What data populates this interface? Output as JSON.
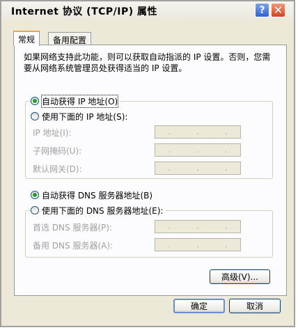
{
  "window": {
    "title": "Internet 协议 (TCP/IP) 属性",
    "help_glyph": "?",
    "close_glyph": "✕"
  },
  "tabs": [
    {
      "label": "常规"
    },
    {
      "label": "备用配置"
    }
  ],
  "description": "如果网络支持此功能，则可以获取自动指派的 IP 设置。否则，您需要从网络系统管理员处获得适当的 IP 设置。",
  "ip_group": {
    "auto_label": "自动获得 IP 地址(O)",
    "manual_label": "使用下面的 IP 地址(S):",
    "fields": [
      {
        "label": "IP 地址(I):"
      },
      {
        "label": "子网掩码(U):"
      },
      {
        "label": "默认网关(D):"
      }
    ]
  },
  "dns_group": {
    "auto_label": "自动获得 DNS 服务器地址(B)",
    "manual_label": "使用下面的 DNS 服务器地址(E):",
    "fields": [
      {
        "label": "首选 DNS 服务器(P):"
      },
      {
        "label": "备用 DNS 服务器(A):"
      }
    ]
  },
  "ip_dot": ".",
  "buttons": {
    "advanced": "高级(V)...",
    "ok": "确定",
    "cancel": "取消"
  },
  "colors": {
    "radio_selected": "#21a121",
    "tab_highlight": "#f4a43a",
    "panel_bg": "#fcfcfe",
    "window_bg": "#ece9d8"
  }
}
